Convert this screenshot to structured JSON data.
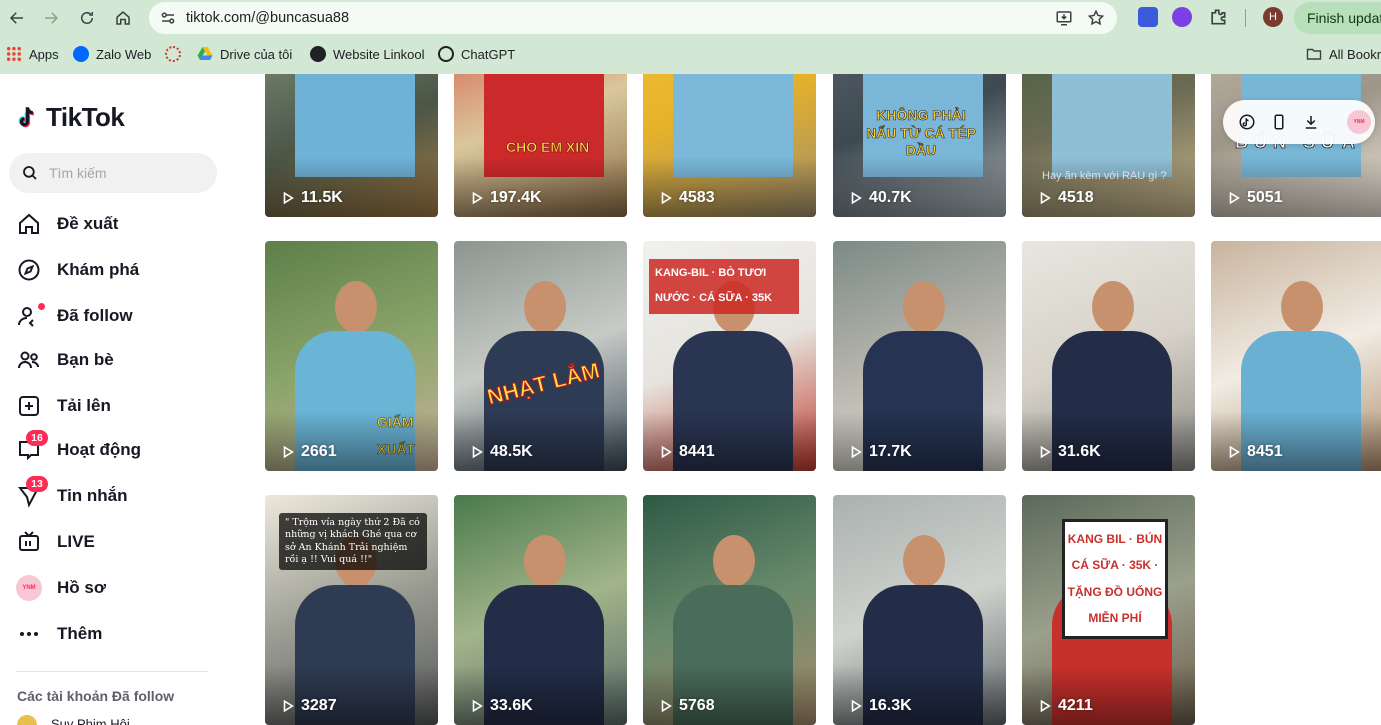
{
  "browser": {
    "url": "tiktok.com/@buncasua88",
    "update_button": "Finish updat",
    "profile_initial": "H",
    "bookmarks": [
      "Apps",
      "Zalo Web",
      "",
      "Drive của tôi",
      "Website Linkool",
      "ChatGPT"
    ],
    "all_bookmarks": "All Bookm"
  },
  "sidebar": {
    "logo": "TikTok",
    "search_placeholder": "Tìm kiếm",
    "nav": [
      {
        "label": "Đề xuất",
        "icon": "home-icon"
      },
      {
        "label": "Khám phá",
        "icon": "compass-icon"
      },
      {
        "label": "Đã follow",
        "icon": "following-icon"
      },
      {
        "label": "Bạn bè",
        "icon": "friends-icon"
      },
      {
        "label": "Tải lên",
        "icon": "upload-icon"
      },
      {
        "label": "Hoạt động",
        "icon": "activity-icon",
        "badge": "16"
      },
      {
        "label": "Tin nhắn",
        "icon": "messages-icon",
        "badge": "13"
      },
      {
        "label": "LIVE",
        "icon": "live-icon"
      },
      {
        "label": "Hồ sơ",
        "icon": "profile-avatar"
      },
      {
        "label": "Thêm",
        "icon": "more-icon"
      }
    ],
    "avatar_text": "YNM",
    "following_title": "Các tài khoản Đã follow",
    "following_peek": "Suy Phim Hội"
  },
  "videos": [
    {
      "views": "11.5K",
      "overlay": ""
    },
    {
      "views": "197.4K",
      "overlay": "CHO EM XIN"
    },
    {
      "views": "4583",
      "overlay": ""
    },
    {
      "views": "40.7K",
      "overlay": "KHÔNG PHẢI NẤU TỪ CÁ TÉP DẦU"
    },
    {
      "views": "4518",
      "overlay": "Hay ăn kèm với RAU gì ?"
    },
    {
      "views": "5051",
      "overlay": "BÚN SỮA"
    },
    {
      "views": "2661",
      "overlay": "GIẤM XUẤT"
    },
    {
      "views": "48.5K",
      "overlay": "NHẠT LẮM"
    },
    {
      "views": "8441",
      "overlay": "KANG-BIL · BÒ TƯƠI NƯỚC · CÁ SỮA · 35K"
    },
    {
      "views": "17.7K",
      "overlay": ""
    },
    {
      "views": "31.6K",
      "overlay": ""
    },
    {
      "views": "8451",
      "overlay": ""
    },
    {
      "views": "3287",
      "overlay": "\" Trộm vía ngày thứ 2 Đã có những vị khách Ghé qua cơ sở An Khánh Trải nghiệm rồi ạ !! Vui quá !!\""
    },
    {
      "views": "33.6K",
      "overlay": ""
    },
    {
      "views": "5768",
      "overlay": ""
    },
    {
      "views": "16.3K",
      "overlay": ""
    },
    {
      "views": "4211",
      "overlay": "KANG BIL · BÚN CÁ SỮA · 35K · TẶNG ĐỒ UỐNG MIỄN PHÍ"
    }
  ],
  "colors": {
    "accent": "#fe2c55",
    "chrome": "#d3e8d4",
    "text": "#161823"
  }
}
